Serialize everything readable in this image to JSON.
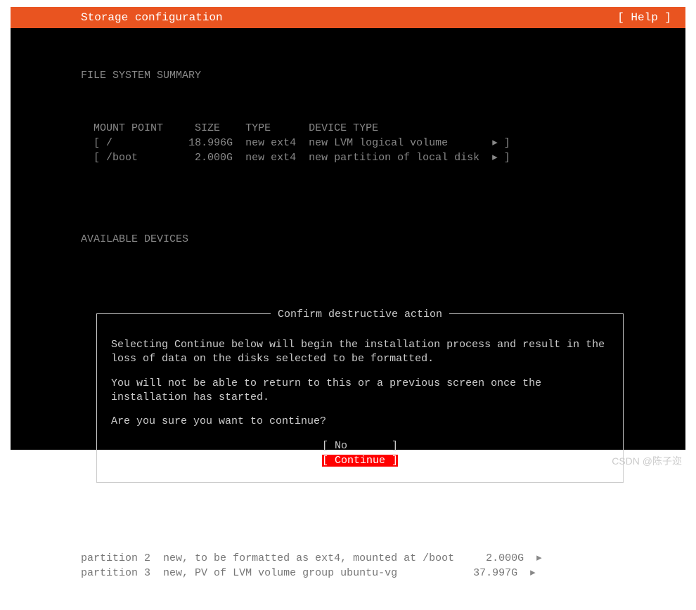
{
  "header": {
    "title": "Storage configuration",
    "help": "[ Help ]"
  },
  "summary": {
    "title": "FILE SYSTEM SUMMARY",
    "columns": {
      "mount": "MOUNT POINT",
      "size": "SIZE",
      "type": "TYPE",
      "devtype": "DEVICE TYPE"
    },
    "rows": [
      {
        "mount": "/",
        "size": "18.996G",
        "type": "new ext4",
        "devtype": "new LVM logical volume",
        "arrow": "▸"
      },
      {
        "mount": "/boot",
        "size": "2.000G",
        "type": "new ext4",
        "devtype": "new partition of local disk",
        "arrow": "▸"
      }
    ]
  },
  "available": {
    "title": "AVAILABLE DEVICES"
  },
  "dialog": {
    "title": "Confirm destructive action",
    "p1": "Selecting Continue below will begin the installation process and result in the loss of data on the disks selected to be formatted.",
    "p2": "You will not be able to return to this or a previous screen once the installation has started.",
    "p3": "Are you sure you want to continue?",
    "no": "No",
    "continue": "Continue"
  },
  "partitions": [
    {
      "name": "partition 2",
      "desc": "new, to be formatted as ext4, mounted at /boot",
      "size": "2.000G",
      "arrow": "▸"
    },
    {
      "name": "partition 3",
      "desc": "new, PV of LVM volume group ubuntu-vg",
      "size": "37.997G",
      "arrow": "▸"
    }
  ],
  "watermark": "CSDN @陈子迩"
}
